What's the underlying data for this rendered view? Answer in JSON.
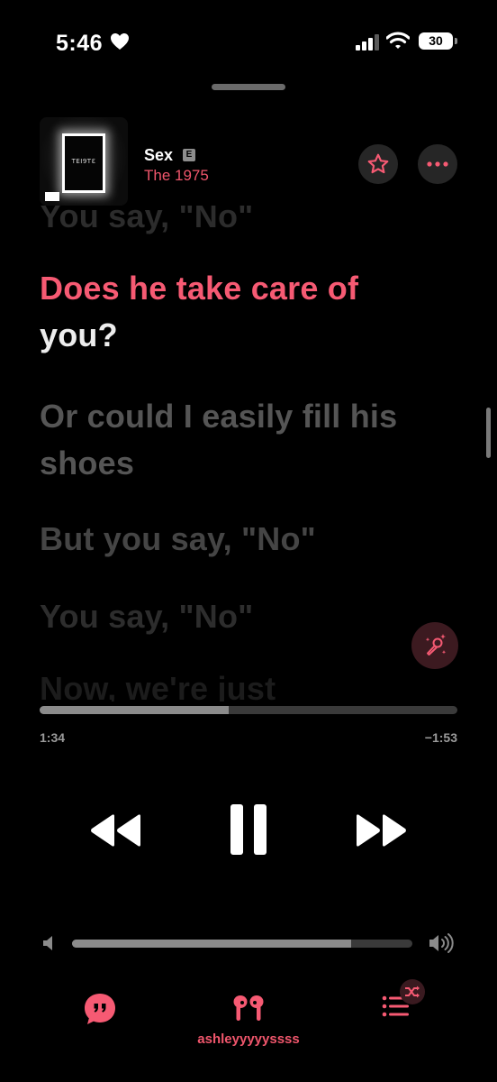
{
  "status_bar": {
    "time": "5:46",
    "battery": "30",
    "icons": [
      "heart-icon",
      "signal-icon",
      "wifi-icon",
      "battery-icon"
    ]
  },
  "now_playing": {
    "title": "Sex",
    "explicit": "E",
    "artist": "The 1975",
    "album_art_text": "TEI9TƐ"
  },
  "lyrics": {
    "previous": "You say, \"No\"",
    "active_sung": "Does he take care of",
    "active_unsung": " you?",
    "upcoming": [
      "Or could I easily fill his shoes",
      "But you say, \"No\"",
      "You say, \"No\"",
      "Now, we're just"
    ]
  },
  "playback": {
    "elapsed": "1:34",
    "remaining": "−1:53",
    "progress": 0.452,
    "volume": 0.82,
    "state": "playing"
  },
  "bottom_bar": {
    "device_name": "ashleyyyyyssss"
  },
  "colors": {
    "accent": "#f65a73",
    "background": "#000000",
    "track": "#3a3a3a",
    "track_fill": "#8b8b8b"
  }
}
